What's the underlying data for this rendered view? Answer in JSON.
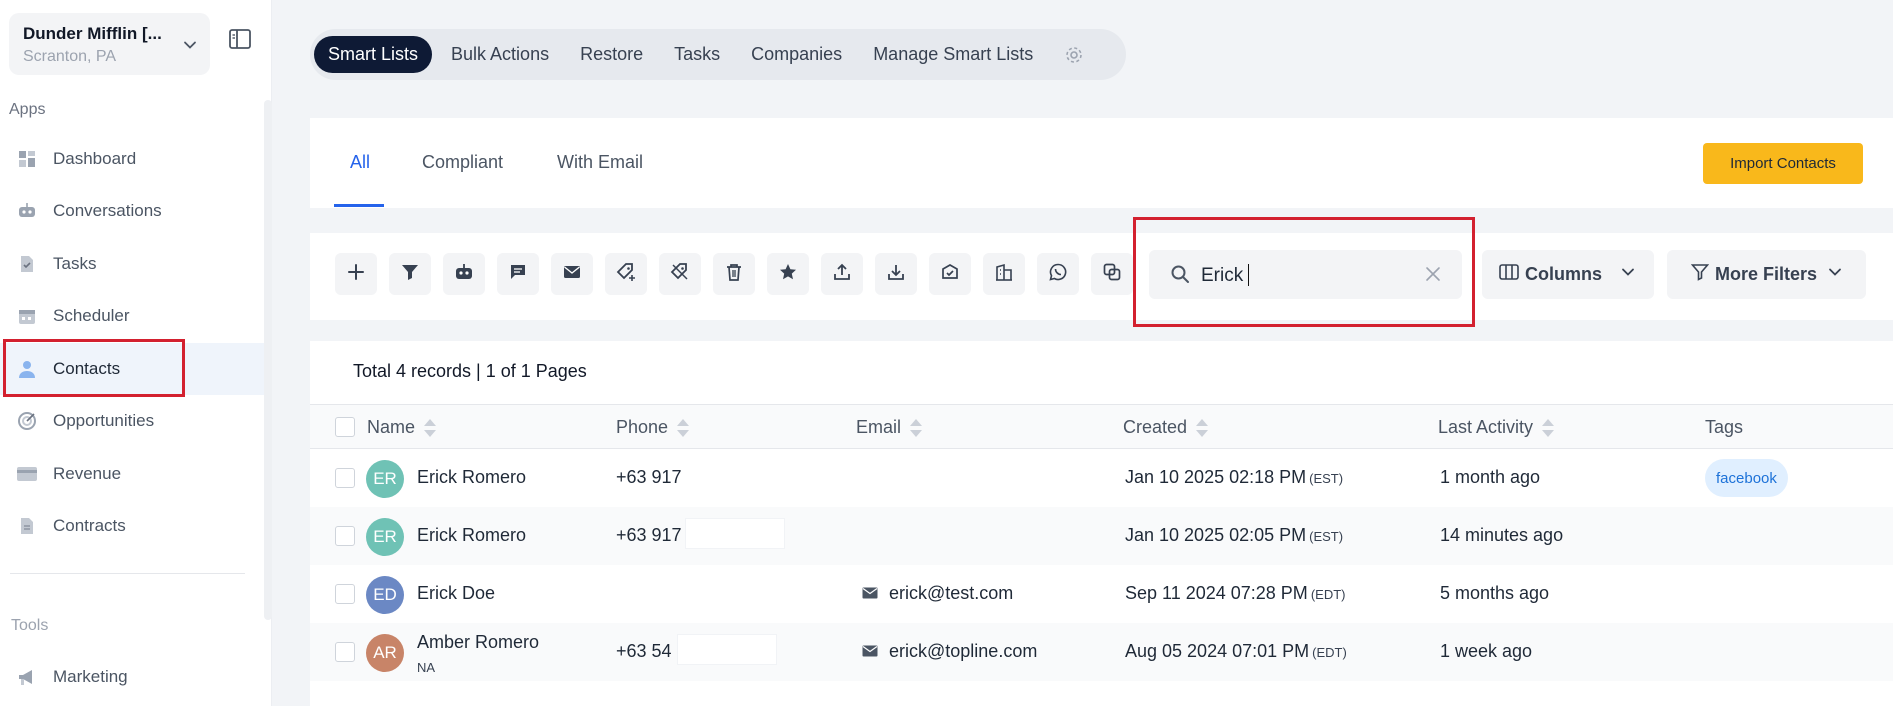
{
  "org": {
    "name": "Dunder Mifflin [...",
    "location": "Scranton, PA"
  },
  "sidebar": {
    "apps_title": "Apps",
    "items": [
      {
        "label": "Dashboard",
        "icon": "dashboard-icon"
      },
      {
        "label": "Conversations",
        "icon": "chat-bot-icon"
      },
      {
        "label": "Tasks",
        "icon": "task-icon"
      },
      {
        "label": "Scheduler",
        "icon": "calendar-icon"
      },
      {
        "label": "Contacts",
        "icon": "user-icon",
        "active": true
      },
      {
        "label": "Opportunities",
        "icon": "target-icon"
      },
      {
        "label": "Revenue",
        "icon": "credit-card-icon"
      },
      {
        "label": "Contracts",
        "icon": "document-icon"
      }
    ],
    "tools_title": "Tools",
    "tools": [
      {
        "label": "Marketing",
        "icon": "megaphone-icon"
      }
    ]
  },
  "topnav": {
    "items": [
      "Smart Lists",
      "Bulk Actions",
      "Restore",
      "Tasks",
      "Companies",
      "Manage Smart Lists"
    ],
    "active": "Smart Lists"
  },
  "tabs": {
    "items": [
      "All",
      "Compliant",
      "With Email"
    ],
    "active": "All"
  },
  "import_button": "Import Contacts",
  "toolbar": {
    "icons": [
      "add-icon",
      "filter-icon",
      "bot-icon",
      "message-icon",
      "email-icon",
      "add-tag-icon",
      "remove-tag-icon",
      "delete-icon",
      "star-icon",
      "export-icon",
      "import-icon",
      "email-verify-icon",
      "company-icon",
      "whatsapp-icon",
      "merge-icon"
    ],
    "search_value": "Erick",
    "columns_label": "Columns",
    "more_filters_label": "More Filters"
  },
  "table": {
    "summary": "Total 4 records | 1 of 1 Pages",
    "headers": [
      "Name",
      "Phone",
      "Email",
      "Created",
      "Last Activity",
      "Tags"
    ],
    "rows": [
      {
        "initials": "ER",
        "avatar_color": "#6fc2b5",
        "name": "Erick Romero",
        "subname": "",
        "phone": "+63 917",
        "email": "",
        "created": "Jan 10 2025 02:18 PM",
        "tz": "(EST)",
        "last_activity": "1 month ago",
        "tag": "facebook"
      },
      {
        "initials": "ER",
        "avatar_color": "#6fc2b5",
        "name": "Erick Romero",
        "subname": "",
        "phone": "+63 917",
        "email": "",
        "created": "Jan 10 2025 02:05 PM",
        "tz": "(EST)",
        "last_activity": "14 minutes ago",
        "tag": ""
      },
      {
        "initials": "ED",
        "avatar_color": "#6b88c4",
        "name": "Erick Doe",
        "subname": "",
        "phone": "",
        "email": "erick@test.com",
        "created": "Sep 11 2024 07:28 PM",
        "tz": "(EDT)",
        "last_activity": "5 months ago",
        "tag": ""
      },
      {
        "initials": "AR",
        "avatar_color": "#c88468",
        "name": "Amber Romero",
        "subname": "NA",
        "phone": "+63 54",
        "email": "erick@topline.com",
        "created": "Aug 05 2024 07:01 PM",
        "tz": "(EDT)",
        "last_activity": "1 week ago",
        "tag": ""
      }
    ]
  },
  "colors": {
    "accent": "#2563eb",
    "nav_dark": "#0e1a35",
    "import": "#f9b81b",
    "highlight": "#d3202f",
    "tag_bg": "#e0efff",
    "tag_text": "#1d72d8"
  }
}
